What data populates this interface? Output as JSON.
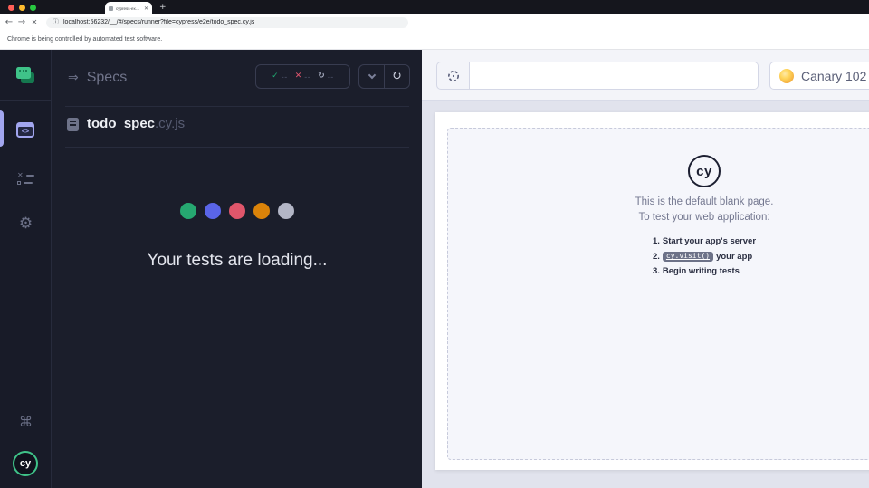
{
  "window": {
    "traffic_lights": [
      {
        "name": "close",
        "color": "#ff5f57"
      },
      {
        "name": "minimize",
        "color": "#febc2e"
      },
      {
        "name": "zoom",
        "color": "#28c840"
      }
    ],
    "tab": {
      "title": "cypress-example-todomvc",
      "close_glyph": "✕"
    },
    "new_tab_glyph": "+",
    "nav": {
      "back_glyph": "←",
      "forward_glyph": "→",
      "stop_glyph": "✕"
    },
    "address": {
      "info_glyph": "ⓘ",
      "url": "localhost:56232/__/#/specs/runner?file=cypress/e2e/todo_spec.cy.js"
    },
    "infobar_text": "Chrome is being controlled by automated test software."
  },
  "icons": {
    "specs_header_glyph": "⇒",
    "gear_glyph": "⚙",
    "command_glyph": "⌘",
    "check_glyph": "✓",
    "cross_glyph": "✕",
    "pending_glyph": "↻",
    "refresh_glyph": "↻",
    "code_glyph": "<>"
  },
  "sidebar": {
    "title": "Specs",
    "stats": {
      "passed": {
        "value": "--",
        "color": "#1fa971"
      },
      "failed": {
        "value": "--",
        "color": "#e45770"
      },
      "pending": {
        "value": "--",
        "color": "#a9aec2"
      }
    },
    "spec": {
      "name": "todo_spec",
      "ext": ".cy.js"
    },
    "dots": [
      {
        "color": "#26a871"
      },
      {
        "color": "#5a65e8"
      },
      {
        "color": "#e0566b"
      },
      {
        "color": "#db8309"
      },
      {
        "color": "#b3b6c6"
      }
    ],
    "loading_text": "Your tests are loading...",
    "logo_text": "cy"
  },
  "aut_header": {
    "url_value": "",
    "browser_name": "Canary 102"
  },
  "blank_page": {
    "logo_text": "cy",
    "line1": "This is the default blank page.",
    "line2": "To test your web application:",
    "steps": [
      {
        "num": "1.",
        "text": "Start your app's server"
      },
      {
        "num": "2.",
        "code": "cy.visit()",
        "text": "your app"
      },
      {
        "num": "3.",
        "text": "Begin writing tests"
      }
    ]
  },
  "colors": {
    "accent_lavender": "#a2a6ef",
    "cypress_green": "#3fc389",
    "canary_gold": "#f2a93c"
  }
}
